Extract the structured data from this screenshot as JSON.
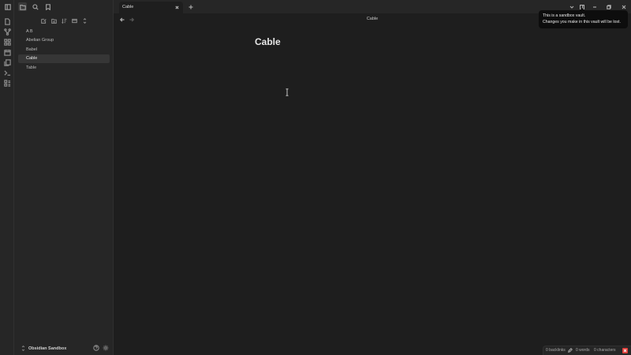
{
  "ribbon": {
    "icons": [
      "file-icon",
      "graph-icon",
      "canvas-icon",
      "calendar-icon",
      "pages-icon",
      "terminal-icon",
      "templates-icon"
    ]
  },
  "sidebar": {
    "top_icons": [
      "sidebar-toggle-icon",
      "folder-icon",
      "search-icon",
      "bookmark-icon"
    ],
    "actions": [
      "new-note-icon",
      "new-folder-icon",
      "sort-icon",
      "collapse-icon",
      "expand-icon"
    ],
    "files": [
      {
        "label": "A B"
      },
      {
        "label": "Abelian Group"
      },
      {
        "label": "Babel"
      },
      {
        "label": "Cable"
      },
      {
        "label": "Table"
      }
    ],
    "active_file": "Cable",
    "vault_name": "Obsidian Sandbox"
  },
  "tab": {
    "title": "Cable"
  },
  "view": {
    "header_title": "Cable",
    "note_title": "Cable"
  },
  "tooltip": {
    "line1": "This is a sandbox vault.",
    "line2": "Changes you make in this vault will be lost."
  },
  "statusbar": {
    "backlinks": "0 backlinks",
    "words": "0 words",
    "characters": "0 characters"
  },
  "colors": {
    "background": "#1e1e1e",
    "sidebar": "#262626",
    "accent_error": "#e0403c"
  }
}
